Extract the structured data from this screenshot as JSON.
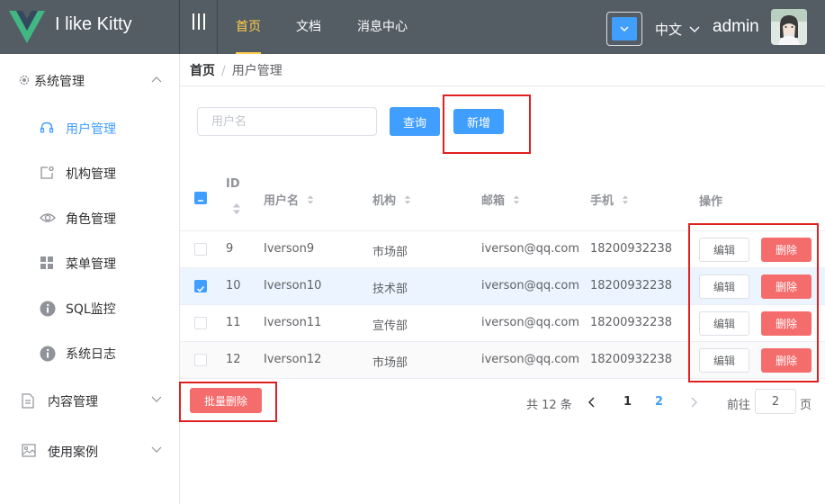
{
  "app": {
    "title": "I like Kitty"
  },
  "header": {
    "nav": [
      {
        "label": "首页",
        "active": true
      },
      {
        "label": "文档",
        "active": false
      },
      {
        "label": "消息中心",
        "active": false
      }
    ],
    "language": "中文",
    "username": "admin"
  },
  "sidebar": {
    "groups": [
      {
        "label": "系统管理",
        "icon": "gear-icon",
        "expanded": true,
        "items": [
          {
            "label": "用户管理",
            "icon": "headset-icon",
            "active": true
          },
          {
            "label": "机构管理",
            "icon": "org-icon",
            "active": false
          },
          {
            "label": "角色管理",
            "icon": "eye-icon",
            "active": false
          },
          {
            "label": "菜单管理",
            "icon": "menu-grid-icon",
            "active": false
          },
          {
            "label": "SQL监控",
            "icon": "info-icon",
            "active": false
          },
          {
            "label": "系统日志",
            "icon": "info-icon",
            "active": false
          }
        ]
      },
      {
        "label": "内容管理",
        "icon": "document-icon",
        "expanded": false
      },
      {
        "label": "使用案例",
        "icon": "picture-icon",
        "expanded": false
      }
    ]
  },
  "breadcrumb": {
    "home": "首页",
    "separator": "/",
    "current": "用户管理"
  },
  "toolbar": {
    "search_placeholder": "用户名",
    "search_value": "",
    "query_label": "查询",
    "add_label": "新增"
  },
  "table": {
    "columns": {
      "id": "ID",
      "username": "用户名",
      "org": "机构",
      "email": "邮箱",
      "phone": "手机",
      "actions": "操作"
    },
    "rows": [
      {
        "id": "9",
        "username": "Iverson9",
        "org": "市场部",
        "email": "iverson@qq.com",
        "phone": "18200932238",
        "checked": false
      },
      {
        "id": "10",
        "username": "Iverson10",
        "org": "技术部",
        "email": "iverson@qq.com",
        "phone": "18200932238",
        "checked": true
      },
      {
        "id": "11",
        "username": "Iverson11",
        "org": "宣传部",
        "email": "iverson@qq.com",
        "phone": "18200932238",
        "checked": false
      },
      {
        "id": "12",
        "username": "Iverson12",
        "org": "市场部",
        "email": "iverson@qq.com",
        "phone": "18200932238",
        "checked": false
      }
    ],
    "edit_label": "编辑",
    "delete_label": "删除"
  },
  "batch_delete_label": "批量删除",
  "pagination": {
    "total_text": "共 12 条",
    "pages": [
      "1",
      "2"
    ],
    "current_page": "2",
    "goto_label": "前往",
    "goto_value": "2",
    "unit": "页"
  },
  "colors": {
    "header_bg": "#545c64",
    "active_nav": "#ffd04b",
    "primary": "#409eff",
    "danger": "#f56c6c",
    "annotation": "#e02020",
    "logo_green": "#41b883",
    "logo_dark": "#35495e"
  }
}
